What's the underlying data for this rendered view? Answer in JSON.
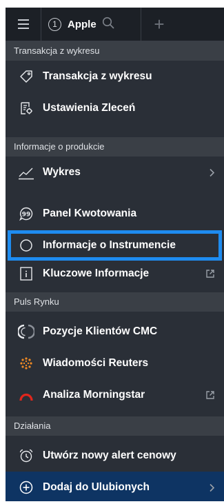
{
  "topbar": {
    "tab_number": "1",
    "tab_name": "Apple",
    "add_label": "+"
  },
  "sections": [
    {
      "header": "Transakcja z wykresu",
      "items": [
        {
          "label": "Transakcja z wykresu",
          "icon": "tag-icon"
        },
        {
          "label": "Ustawienia Zleceń",
          "icon": "order-settings-icon"
        }
      ]
    },
    {
      "header": "Informacje o produkcie",
      "items": [
        {
          "label": "Wykres",
          "icon": "chart-line-icon",
          "trailing": "chevron"
        },
        {
          "label": "Panel Kwotowania",
          "icon": "quote-bubble-icon"
        },
        {
          "label": "Informacje o Instrumencie",
          "icon": "circle-icon",
          "selected": true
        },
        {
          "label": "Kluczowe Informacje",
          "icon": "info-document-icon",
          "trailing": "external"
        }
      ]
    },
    {
      "header": "Puls Rynku",
      "items": [
        {
          "label": "Pozycje Klientów CMC",
          "icon": "cmc-positions-icon"
        },
        {
          "label": "Wiadomości Reuters",
          "icon": "reuters-icon"
        },
        {
          "label": "Analiza Morningstar",
          "icon": "morningstar-icon",
          "trailing": "external"
        }
      ]
    },
    {
      "header": "Działania",
      "items": [
        {
          "label": "Utwórz nowy alert cenowy",
          "icon": "alarm-clock-icon"
        },
        {
          "label": "Dodaj do Ulubionych",
          "icon": "plus-circle-icon",
          "trailing": "chevron",
          "highlight": true
        }
      ]
    }
  ],
  "colors": {
    "panel_bg": "#2a2f37",
    "header_bg": "#3a3f46",
    "topbar_bg": "#1c2026",
    "selection_border": "#1e8cf0",
    "favorite_bg": "#0e3463",
    "morningstar_red": "#e0261c",
    "reuters_orange": "#f08a24"
  }
}
